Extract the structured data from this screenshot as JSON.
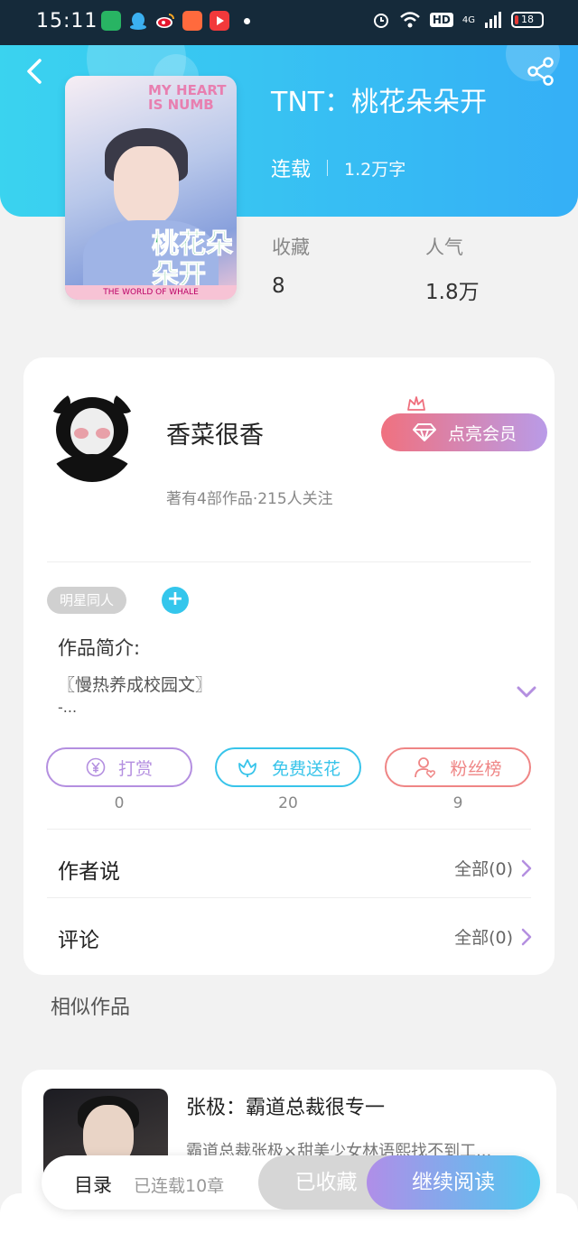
{
  "status_bar": {
    "time": "15:11",
    "network": "4G",
    "hd": "HD",
    "battery": "18"
  },
  "book": {
    "title": "TNT：桃花朵朵开",
    "status": "连载",
    "word_count": "1.2万字",
    "cover_text_top": "MY HEART IS NUMB",
    "cover_text_big": "桃花朵朵开",
    "cover_text_bottom": "THE WORLD OF WHALE"
  },
  "stats": [
    {
      "label": "收藏",
      "value": "8"
    },
    {
      "label": "人气",
      "value": "1.8万"
    }
  ],
  "author": {
    "name": "香菜很香",
    "info": "著有4部作品·215人关注",
    "vip_label": "点亮会员"
  },
  "tags": [
    "明星同人"
  ],
  "intro": {
    "label": "作品简介:",
    "text": "〖慢热养成校园文〗",
    "more": "-..."
  },
  "actions": [
    {
      "label": "打赏",
      "count": "0",
      "color": "#b48fe0"
    },
    {
      "label": "免费送花",
      "count": "20",
      "color": "#38c4ea"
    },
    {
      "label": "粉丝榜",
      "count": "9",
      "color": "#ef8585"
    }
  ],
  "rows": [
    {
      "label": "作者说",
      "right": "全部(0)"
    },
    {
      "label": "评论",
      "right": "全部(0)"
    }
  ],
  "similar": {
    "section_title": "相似作品",
    "items": [
      {
        "title": "张极：霸道总裁很专一",
        "desc": "霸道总裁张极×甜美少女林语熙找不到工..."
      }
    ]
  },
  "bottom_bar": {
    "toc": "目录",
    "toc_sub": "已连载10章",
    "saved": "已收藏",
    "read": "继续阅读"
  }
}
